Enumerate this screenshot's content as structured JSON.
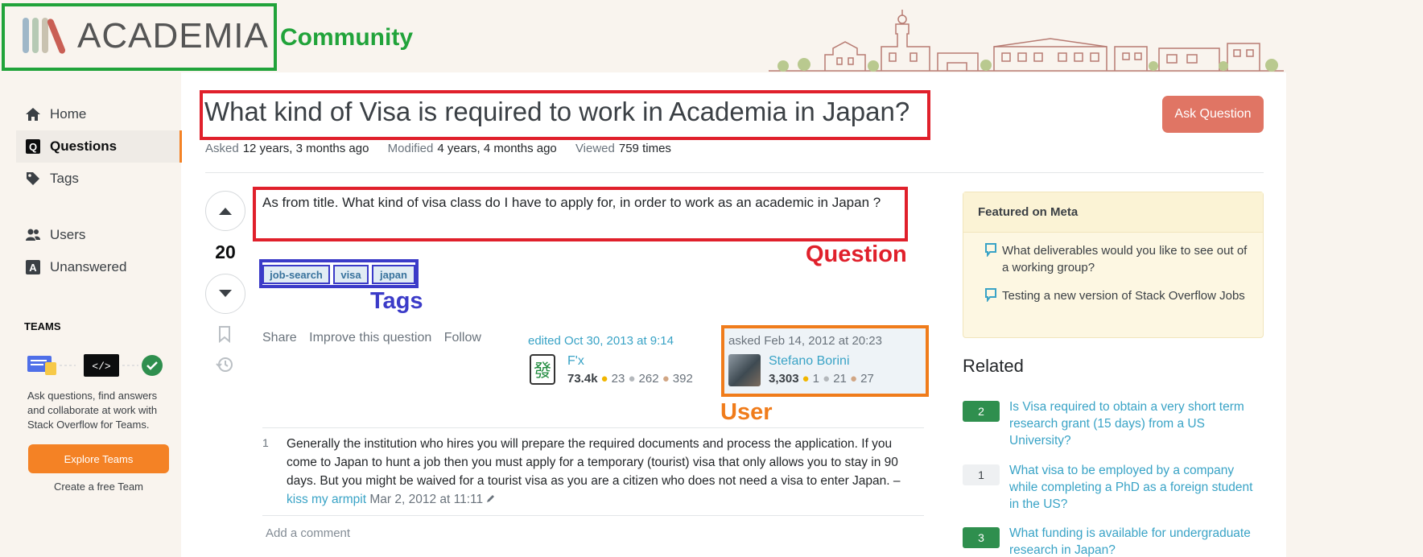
{
  "header": {
    "logo_text": "ACADEMIA",
    "community_label": "Community"
  },
  "sidebar": {
    "items": [
      {
        "label": "Home",
        "icon": "home-icon"
      },
      {
        "label": "Questions",
        "icon": "questions-icon",
        "active": true
      },
      {
        "label": "Tags",
        "icon": "tag-icon"
      },
      {
        "label": "Users",
        "icon": "users-icon"
      },
      {
        "label": "Unanswered",
        "icon": "unanswered-icon"
      }
    ],
    "teams_heading": "TEAMS",
    "teams_text": "Ask questions, find answers and collaborate at work with Stack Overflow for Teams.",
    "explore_button": "Explore Teams",
    "free_team_link": "Create a free Team"
  },
  "question": {
    "title": "What kind of Visa is required to work in Academia in Japan?",
    "ask_button": "Ask Question",
    "asked_label": "Asked",
    "asked_value": "12 years, 3 months ago",
    "modified_label": "Modified",
    "modified_value": "4 years, 4 months ago",
    "viewed_label": "Viewed",
    "viewed_value": "759 times",
    "votes": "20",
    "body": "As from title. What kind of visa class do I have to apply for, in order to work as an academic in Japan ?",
    "tags": [
      "job-search",
      "visa",
      "japan"
    ],
    "menu": [
      "Share",
      "Improve this question",
      "Follow"
    ],
    "editor": {
      "time": "edited Oct 30, 2013 at 9:14",
      "name": "F'x",
      "avatar_glyph": "發",
      "rep": "73.4k",
      "gold": "23",
      "silver": "262",
      "bronze": "392"
    },
    "asker": {
      "time": "asked Feb 14, 2012 at 20:23",
      "name": "Stefano Borini",
      "rep": "3,303",
      "gold": "1",
      "silver": "21",
      "bronze": "27"
    }
  },
  "annotations": {
    "question_label": "Question",
    "tags_label": "Tags",
    "user_label": "User"
  },
  "comment": {
    "score": "1",
    "text": "Generally the institution who hires you will prepare the required documents and process the application. If you come to Japan to hunt a job then you must apply for a temporary (tourist) visa that only allows you to stay in 90 days. But you might be waived for a tourist visa as you are a citizen who does not need a visa to enter Japan. –",
    "user": "kiss my armpit",
    "date": "Mar 2, 2012 at 11:11",
    "add_label": "Add a comment"
  },
  "featured": {
    "heading": "Featured on Meta",
    "items": [
      "What deliverables would you like to see out of a working group?",
      "Testing a new version of Stack Overflow Jobs"
    ]
  },
  "related": {
    "heading": "Related",
    "items": [
      {
        "count": "2",
        "answered": true,
        "title": "Is Visa required to obtain a very short term research grant (15 days) from a US University?"
      },
      {
        "count": "1",
        "answered": false,
        "title": "What visa to be employed by a company while completing a PhD as a foreign student in the US?"
      },
      {
        "count": "3",
        "answered": true,
        "title": "What funding is available for undergraduate research in Japan?"
      }
    ]
  },
  "colors": {
    "annotation_green": "#21a33a",
    "annotation_red": "#e0202b",
    "annotation_blue": "#3b3bc8",
    "annotation_orange": "#f07c1b",
    "brand_orange": "#f48225",
    "link_blue": "#39a3c6"
  }
}
